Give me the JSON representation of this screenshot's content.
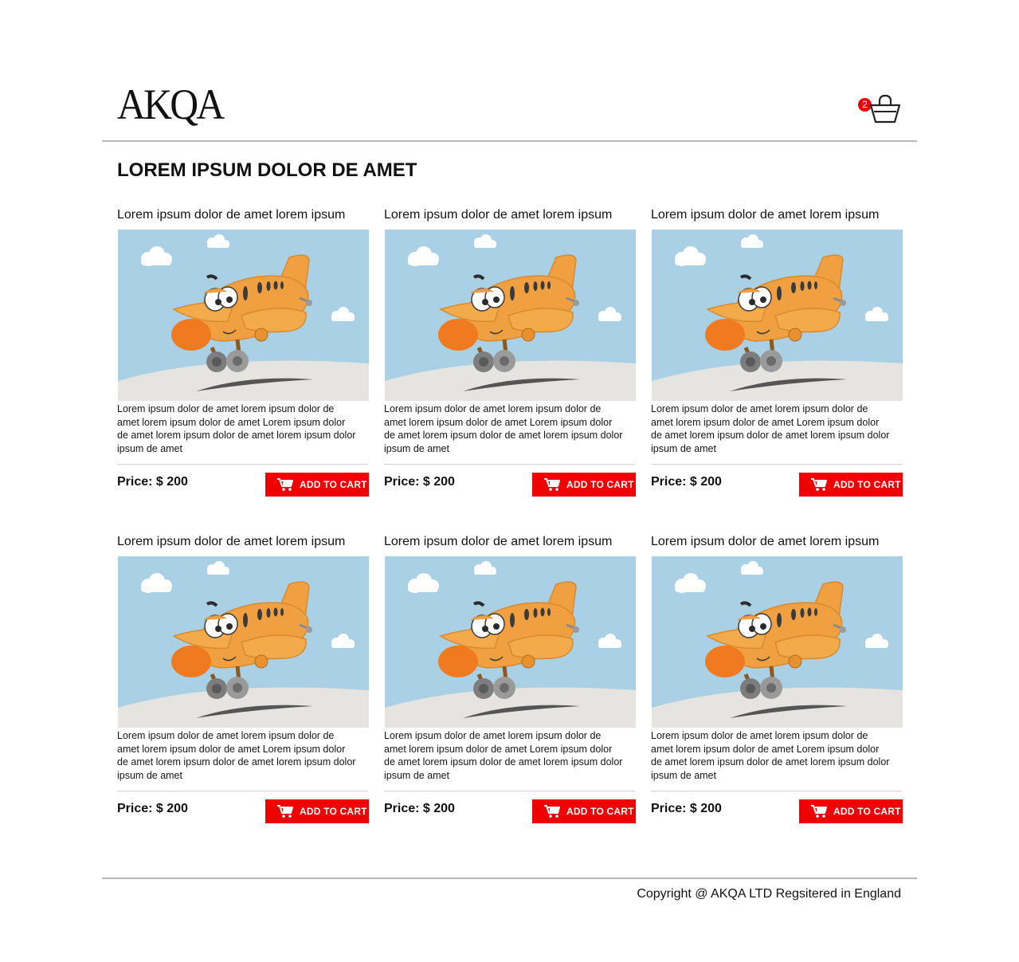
{
  "header": {
    "logo": "AKQA",
    "cart_count": "2"
  },
  "page_title": "LOREM IPSUM DOLOR DE AMET",
  "products": [
    {
      "title": "Lorem ipsum dolor de amet lorem ipsum",
      "description": "Lorem ipsum dolor de amet lorem ipsum dolor de amet lorem ipsum dolor de amet Lorem ipsum dolor de amet lorem ipsum dolor de amet lorem ipsum dolor ipsum de amet",
      "price": "Price: $ 200",
      "button_label": "ADD TO CART"
    },
    {
      "title": "Lorem ipsum dolor de amet lorem ipsum",
      "description": "Lorem ipsum dolor de amet lorem ipsum dolor de amet lorem ipsum dolor de amet Lorem ipsum dolor de amet lorem ipsum dolor de amet lorem ipsum dolor ipsum de amet",
      "price": "Price: $ 200",
      "button_label": "ADD TO CART"
    },
    {
      "title": "Lorem ipsum dolor de amet lorem ipsum",
      "description": "Lorem ipsum dolor de amet lorem ipsum dolor de amet lorem ipsum dolor de amet Lorem ipsum dolor de amet lorem ipsum dolor de amet lorem ipsum dolor ipsum de amet",
      "price": "Price: $ 200",
      "button_label": "ADD TO CART"
    },
    {
      "title": "Lorem ipsum dolor de amet lorem ipsum",
      "description": "Lorem ipsum dolor de amet lorem ipsum dolor de amet lorem ipsum dolor de amet Lorem ipsum dolor de amet lorem ipsum dolor de amet lorem ipsum dolor ipsum de amet",
      "price": "Price: $ 200",
      "button_label": "ADD TO CART"
    },
    {
      "title": "Lorem ipsum dolor de amet lorem ipsum",
      "description": "Lorem ipsum dolor de amet lorem ipsum dolor de amet lorem ipsum dolor de amet Lorem ipsum dolor de amet lorem ipsum dolor de amet lorem ipsum dolor ipsum de amet",
      "price": "Price: $ 200",
      "button_label": "ADD TO CART"
    },
    {
      "title": "Lorem ipsum dolor de amet lorem ipsum",
      "description": "Lorem ipsum dolor de amet lorem ipsum dolor de amet lorem ipsum dolor de amet Lorem ipsum dolor de amet lorem ipsum dolor de amet lorem ipsum dolor ipsum de amet",
      "price": "Price: $ 200",
      "button_label": "ADD TO CART"
    }
  ],
  "footer": {
    "copyright": "Copyright @ AKQA LTD Regsitered in England"
  },
  "icons": {
    "cart": "shopping-basket-icon",
    "button": "shopping-cart-icon",
    "product_image": "cartoon-airplane-illustration"
  },
  "colors": {
    "accent": "#f00000",
    "badge": "#ee0000",
    "divider": "#b8b8b8",
    "sky": "#a9d0e5",
    "ground": "#e5e4e0",
    "plane": "#f0a040",
    "plane_nose": "#f07a20"
  }
}
